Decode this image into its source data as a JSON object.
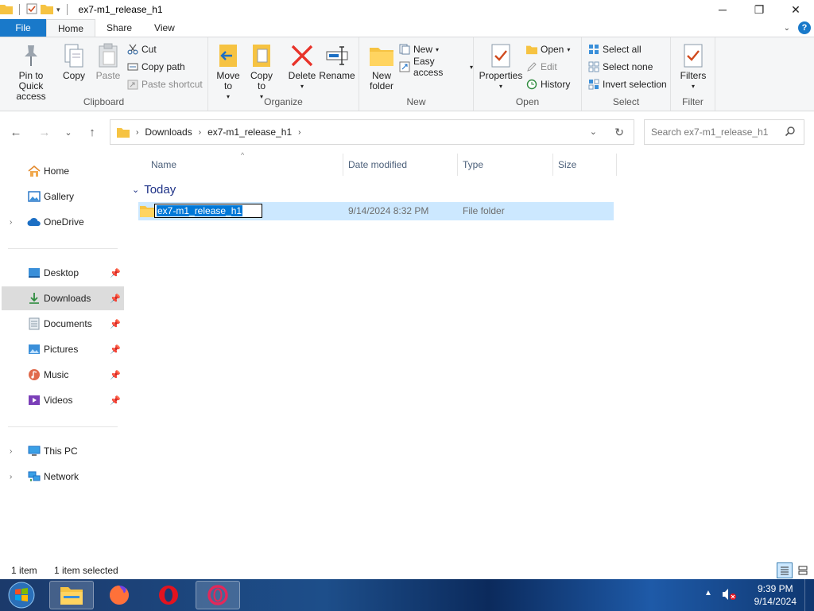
{
  "window": {
    "title": "ex7-m1_release_h1",
    "minimize_icon": "─",
    "maximize_icon": "❐",
    "close_icon": "✕"
  },
  "ribbon_tabs": [
    "File",
    "Home",
    "Share",
    "View"
  ],
  "help": "?",
  "ribbon": {
    "clipboard": {
      "label": "Clipboard",
      "pin": "Pin to Quick access",
      "copy": "Copy",
      "paste": "Paste",
      "cut": "Cut",
      "copy_path": "Copy path",
      "paste_shortcut": "Paste shortcut"
    },
    "organize": {
      "label": "Organize",
      "move_to": "Move to",
      "copy_to": "Copy to",
      "delete": "Delete",
      "rename": "Rename"
    },
    "new": {
      "label": "New",
      "new_folder": "New folder",
      "new_item": "New",
      "easy_access": "Easy access"
    },
    "open": {
      "label": "Open",
      "properties": "Properties",
      "open": "Open",
      "edit": "Edit",
      "history": "History"
    },
    "select": {
      "label": "Select",
      "select_all": "Select all",
      "select_none": "Select none",
      "invert_selection": "Invert selection"
    },
    "filter": {
      "label": "Filter",
      "filters": "Filters"
    }
  },
  "address": {
    "crumbs": [
      "Downloads",
      "ex7-m1_release_h1"
    ],
    "search_placeholder": "Search ex7-m1_release_h1"
  },
  "nav_pane": {
    "home": "Home",
    "gallery": "Gallery",
    "onedrive": "OneDrive",
    "desktop": "Desktop",
    "downloads": "Downloads",
    "documents": "Documents",
    "pictures": "Pictures",
    "music": "Music",
    "videos": "Videos",
    "this_pc": "This PC",
    "network": "Network"
  },
  "columns": {
    "name": "Name",
    "date_modified": "Date modified",
    "type": "Type",
    "size": "Size"
  },
  "group_header": "Today",
  "files": [
    {
      "name": "ex7-m1_release_h1",
      "date_modified": "9/14/2024 8:32 PM",
      "type": "File folder",
      "size": ""
    }
  ],
  "status": {
    "count": "1 item",
    "selected": "1 item selected"
  },
  "taskbar": {
    "time": "9:39 PM",
    "date": "9/14/2024"
  },
  "colors": {
    "accent": "#1979ca",
    "selection": "#cce8ff",
    "folder": "#f6c342"
  }
}
